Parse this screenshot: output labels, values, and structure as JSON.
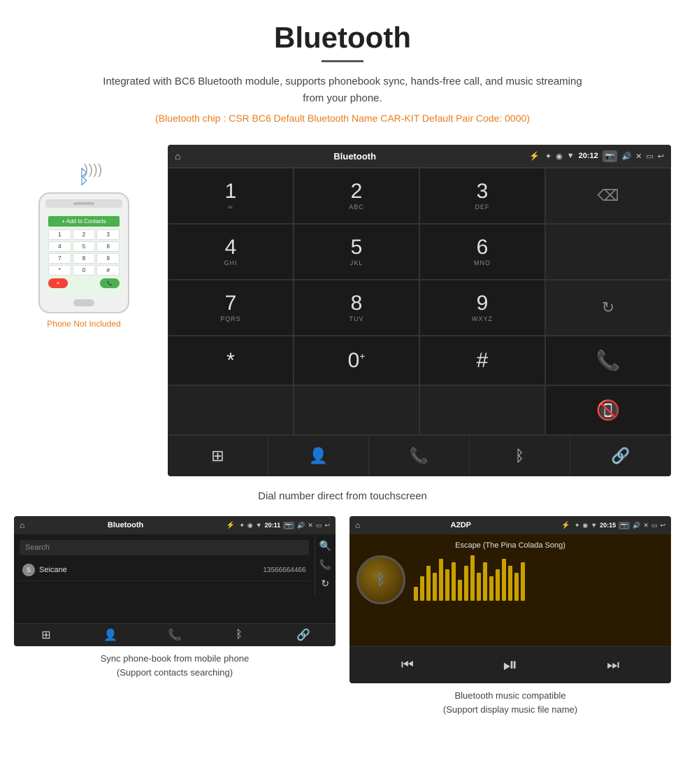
{
  "header": {
    "title": "Bluetooth",
    "description": "Integrated with BC6 Bluetooth module, supports phonebook sync, hands-free call, and music streaming from your phone.",
    "spec_line": "(Bluetooth chip : CSR BC6    Default Bluetooth Name CAR-KIT    Default Pair Code: 0000)"
  },
  "main_screen": {
    "status_bar": {
      "title": "Bluetooth",
      "time": "20:12",
      "home_icon": "⌂",
      "usb_icon": "⚡",
      "bt_icon": "✦",
      "location_icon": "◉",
      "wifi_icon": "▼",
      "camera_icon": "📷",
      "volume_icon": "🔊",
      "close_icon": "✕",
      "window_icon": "▭",
      "back_icon": "↩"
    },
    "dialpad": {
      "keys": [
        {
          "num": "1",
          "letters": "∞"
        },
        {
          "num": "2",
          "letters": "ABC"
        },
        {
          "num": "3",
          "letters": "DEF"
        },
        {
          "num": "",
          "letters": "",
          "type": "empty"
        },
        {
          "num": "4",
          "letters": "GHI"
        },
        {
          "num": "5",
          "letters": "JKL"
        },
        {
          "num": "6",
          "letters": "MNO"
        },
        {
          "num": "",
          "letters": "",
          "type": "empty"
        },
        {
          "num": "7",
          "letters": "PQRS"
        },
        {
          "num": "8",
          "letters": "TUV"
        },
        {
          "num": "9",
          "letters": "WXYZ"
        },
        {
          "num": "",
          "letters": "",
          "type": "sync"
        },
        {
          "num": "*",
          "letters": ""
        },
        {
          "num": "0",
          "letters": "+"
        },
        {
          "num": "#",
          "letters": ""
        },
        {
          "num": "",
          "letters": "",
          "type": "call-green"
        },
        {
          "num": "",
          "letters": "",
          "type": "empty"
        },
        {
          "num": "",
          "letters": "",
          "type": "empty"
        },
        {
          "num": "",
          "letters": "",
          "type": "empty"
        },
        {
          "num": "",
          "letters": "",
          "type": "call-red"
        }
      ]
    },
    "toolbar": [
      "⊞",
      "👤",
      "📞",
      "✦",
      "🔗"
    ]
  },
  "dial_caption": "Dial number direct from touchscreen",
  "phonebook_screen": {
    "status_bar": {
      "title": "Bluetooth",
      "time": "20:11"
    },
    "search_placeholder": "Search",
    "contact": {
      "letter": "S",
      "name": "Seicane",
      "number": "13566664466"
    },
    "right_icons": [
      "🔍",
      "📞",
      "🔄"
    ],
    "toolbar": [
      "⊞",
      "👤",
      "📞",
      "✦",
      "🔗"
    ]
  },
  "music_screen": {
    "status_bar": {
      "title": "A2DP",
      "time": "20:15"
    },
    "song_title": "Escape (The Pina Colada Song)",
    "music_bars": [
      20,
      35,
      50,
      40,
      60,
      45,
      55,
      30,
      50,
      65,
      40,
      55,
      35,
      45,
      60,
      50,
      40,
      55
    ],
    "controls": [
      "⏮",
      "⏯",
      "⏭"
    ]
  },
  "phonebook_caption": "Sync phone-book from mobile phone\n(Support contacts searching)",
  "music_caption": "Bluetooth music compatible\n(Support display music file name)",
  "phone_not_included": "Phone Not Included"
}
